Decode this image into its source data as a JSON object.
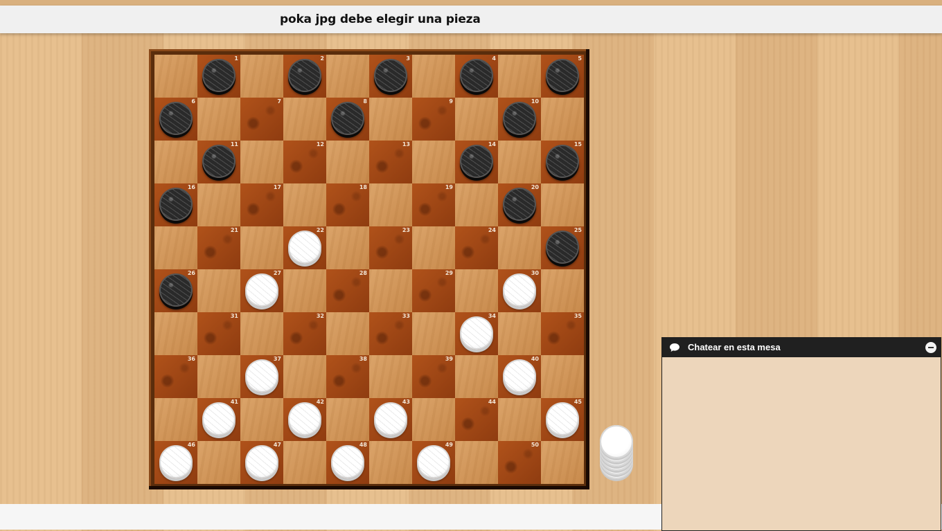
{
  "status": {
    "message": "poka jpg debe elegir una pieza"
  },
  "board": {
    "squares": [
      {
        "n": 1,
        "piece": "black"
      },
      {
        "n": 2,
        "piece": "black"
      },
      {
        "n": 3,
        "piece": "black"
      },
      {
        "n": 4,
        "piece": "black"
      },
      {
        "n": 5,
        "piece": "black"
      },
      {
        "n": 6,
        "piece": "black"
      },
      {
        "n": 7,
        "piece": ""
      },
      {
        "n": 8,
        "piece": "black"
      },
      {
        "n": 9,
        "piece": ""
      },
      {
        "n": 10,
        "piece": "black"
      },
      {
        "n": 11,
        "piece": "black"
      },
      {
        "n": 12,
        "piece": ""
      },
      {
        "n": 13,
        "piece": ""
      },
      {
        "n": 14,
        "piece": "black"
      },
      {
        "n": 15,
        "piece": "black"
      },
      {
        "n": 16,
        "piece": "black"
      },
      {
        "n": 17,
        "piece": ""
      },
      {
        "n": 18,
        "piece": ""
      },
      {
        "n": 19,
        "piece": ""
      },
      {
        "n": 20,
        "piece": "black"
      },
      {
        "n": 21,
        "piece": ""
      },
      {
        "n": 22,
        "piece": "white"
      },
      {
        "n": 23,
        "piece": ""
      },
      {
        "n": 24,
        "piece": ""
      },
      {
        "n": 25,
        "piece": "black"
      },
      {
        "n": 26,
        "piece": "black"
      },
      {
        "n": 27,
        "piece": "white"
      },
      {
        "n": 28,
        "piece": ""
      },
      {
        "n": 29,
        "piece": ""
      },
      {
        "n": 30,
        "piece": "white"
      },
      {
        "n": 31,
        "piece": ""
      },
      {
        "n": 32,
        "piece": ""
      },
      {
        "n": 33,
        "piece": ""
      },
      {
        "n": 34,
        "piece": "white"
      },
      {
        "n": 35,
        "piece": ""
      },
      {
        "n": 36,
        "piece": ""
      },
      {
        "n": 37,
        "piece": "white"
      },
      {
        "n": 38,
        "piece": ""
      },
      {
        "n": 39,
        "piece": ""
      },
      {
        "n": 40,
        "piece": "white"
      },
      {
        "n": 41,
        "piece": "white"
      },
      {
        "n": 42,
        "piece": "white"
      },
      {
        "n": 43,
        "piece": "white"
      },
      {
        "n": 44,
        "piece": ""
      },
      {
        "n": 45,
        "piece": "white"
      },
      {
        "n": 46,
        "piece": "white"
      },
      {
        "n": 47,
        "piece": "white"
      },
      {
        "n": 48,
        "piece": "white"
      },
      {
        "n": 49,
        "piece": "white"
      },
      {
        "n": 50,
        "piece": ""
      }
    ]
  },
  "captured": {
    "color": "white",
    "count": 6
  },
  "chat": {
    "title": "Chatear en esta mesa",
    "icon": "chat-bubble-icon",
    "minimize_icon": "minimize-icon"
  },
  "colors": {
    "header_bg": "#202020",
    "chat_bg": "#edd6bb",
    "status_bg": "#f0f0f0"
  }
}
